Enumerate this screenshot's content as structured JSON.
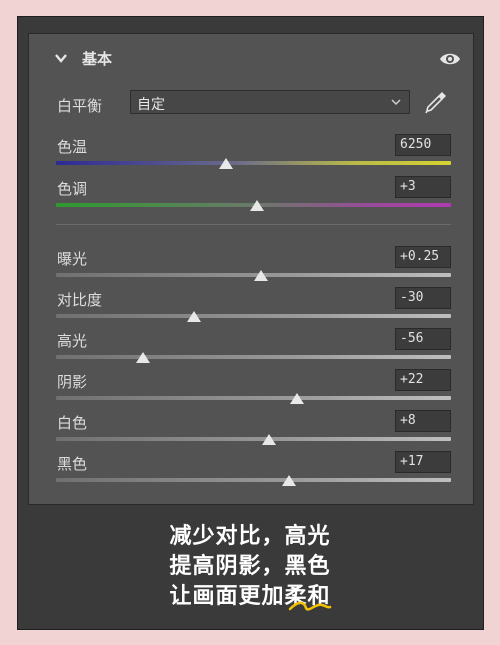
{
  "panel": {
    "title": "基本",
    "white_balance": {
      "label": "白平衡",
      "value": "自定"
    }
  },
  "sliders": [
    {
      "label": "色温",
      "value": "6250",
      "position": 0.43,
      "track": "temp"
    },
    {
      "label": "色调",
      "value": "+3",
      "position": 0.51,
      "track": "tint"
    },
    {
      "label": "曝光",
      "value": "+0.25",
      "position": 0.52,
      "track": "plain"
    },
    {
      "label": "对比度",
      "value": "-30",
      "position": 0.35,
      "track": "plain"
    },
    {
      "label": "高光",
      "value": "-56",
      "position": 0.22,
      "track": "plain"
    },
    {
      "label": "阴影",
      "value": "+22",
      "position": 0.61,
      "track": "plain"
    },
    {
      "label": "白色",
      "value": "+8",
      "position": 0.54,
      "track": "plain"
    },
    {
      "label": "黑色",
      "value": "+17",
      "position": 0.59,
      "track": "plain"
    }
  ],
  "caption": {
    "line1": "减少对比，高光",
    "line2": "提高阴影，黑色",
    "line3": "让画面更加柔和"
  },
  "icons": {
    "collapse": "chevron-down-icon",
    "visibility": "eye-icon",
    "picker": "eyedropper-icon",
    "dropdown": "chevron-down-icon"
  },
  "colors": {
    "accent_squiggle": "#f2c200",
    "panel_bg": "#535353",
    "frame_bg": "#3a3a3a",
    "page_bg": "#f1d3d3"
  }
}
